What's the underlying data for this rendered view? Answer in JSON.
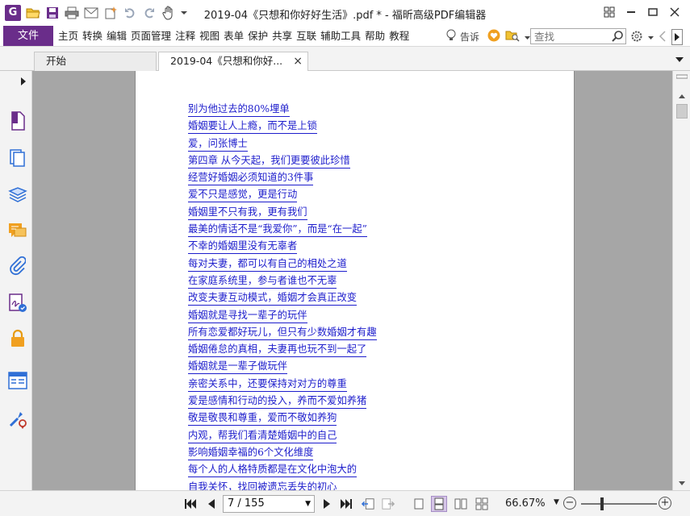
{
  "window": {
    "title": "2019-04《只想和你好好生活》.pdf * - 福昕高级PDF编辑器",
    "logo_letter": "G"
  },
  "quick_access_icons": [
    "open-folder-icon",
    "save-icon",
    "print-icon",
    "email-icon",
    "new-icon",
    "undo-icon",
    "redo-icon",
    "hand-tool-icon"
  ],
  "menu": {
    "file_label": "文件",
    "items": [
      "主页",
      "转换",
      "编辑",
      "页面管理",
      "注释",
      "视图",
      "表单",
      "保护",
      "共享",
      "互联",
      "辅助工具",
      "帮助",
      "教程"
    ],
    "tell_me": "告诉",
    "search_placeholder": "查找"
  },
  "tabs": [
    {
      "label": "开始"
    },
    {
      "label": "2019-04《只想和你好...",
      "close": "×"
    }
  ],
  "sidebar_icons": [
    "pages-icon",
    "thumbnails-icon",
    "layers-icon",
    "comments-icon",
    "attachments-icon",
    "signature-icon",
    "lock-icon",
    "form-fields-icon",
    "tools-icon"
  ],
  "document": {
    "toc": [
      "别为他过去的80%埋单",
      "婚姻要让人上瘾，而不是上锁",
      "爱，问张博士",
      "第四章 从今天起，我们更要彼此珍惜",
      "经营好婚姻必须知道的3件事",
      "爱不只是感觉，更是行动",
      "婚姻里不只有我，更有我们",
      "最美的情话不是“我爱你”，而是“在一起”",
      "不幸的婚姻里没有无辜者",
      "每对夫妻，都可以有自己的相处之道",
      "在家庭系统里，参与者谁也不无辜",
      "改变夫妻互动模式，婚姻才会真正改变",
      "婚姻就是寻找一辈子的玩伴",
      "所有恋爱都好玩儿，但只有少数婚姻才有趣",
      "婚姻倦怠的真相，夫妻再也玩不到一起了",
      "婚姻就是一辈子做玩伴",
      "亲密关系中，还要保持对对方的尊重",
      "爱是感情和行动的投入，养而不爱如养猪",
      "敬是敬畏和尊重，爱而不敬如养狗",
      "内观，帮我们看清楚婚姻中的自己",
      "影响婚姻幸福的6个文化维度",
      "每个人的人格特质都是在文化中泡大的",
      "自我关怀，找回被遗忘丢失的初心"
    ]
  },
  "status": {
    "page_display": "7 / 155",
    "current_page": 7,
    "total_pages": 155,
    "zoom": "66.67%",
    "accent_color": "#6a2d8a"
  }
}
